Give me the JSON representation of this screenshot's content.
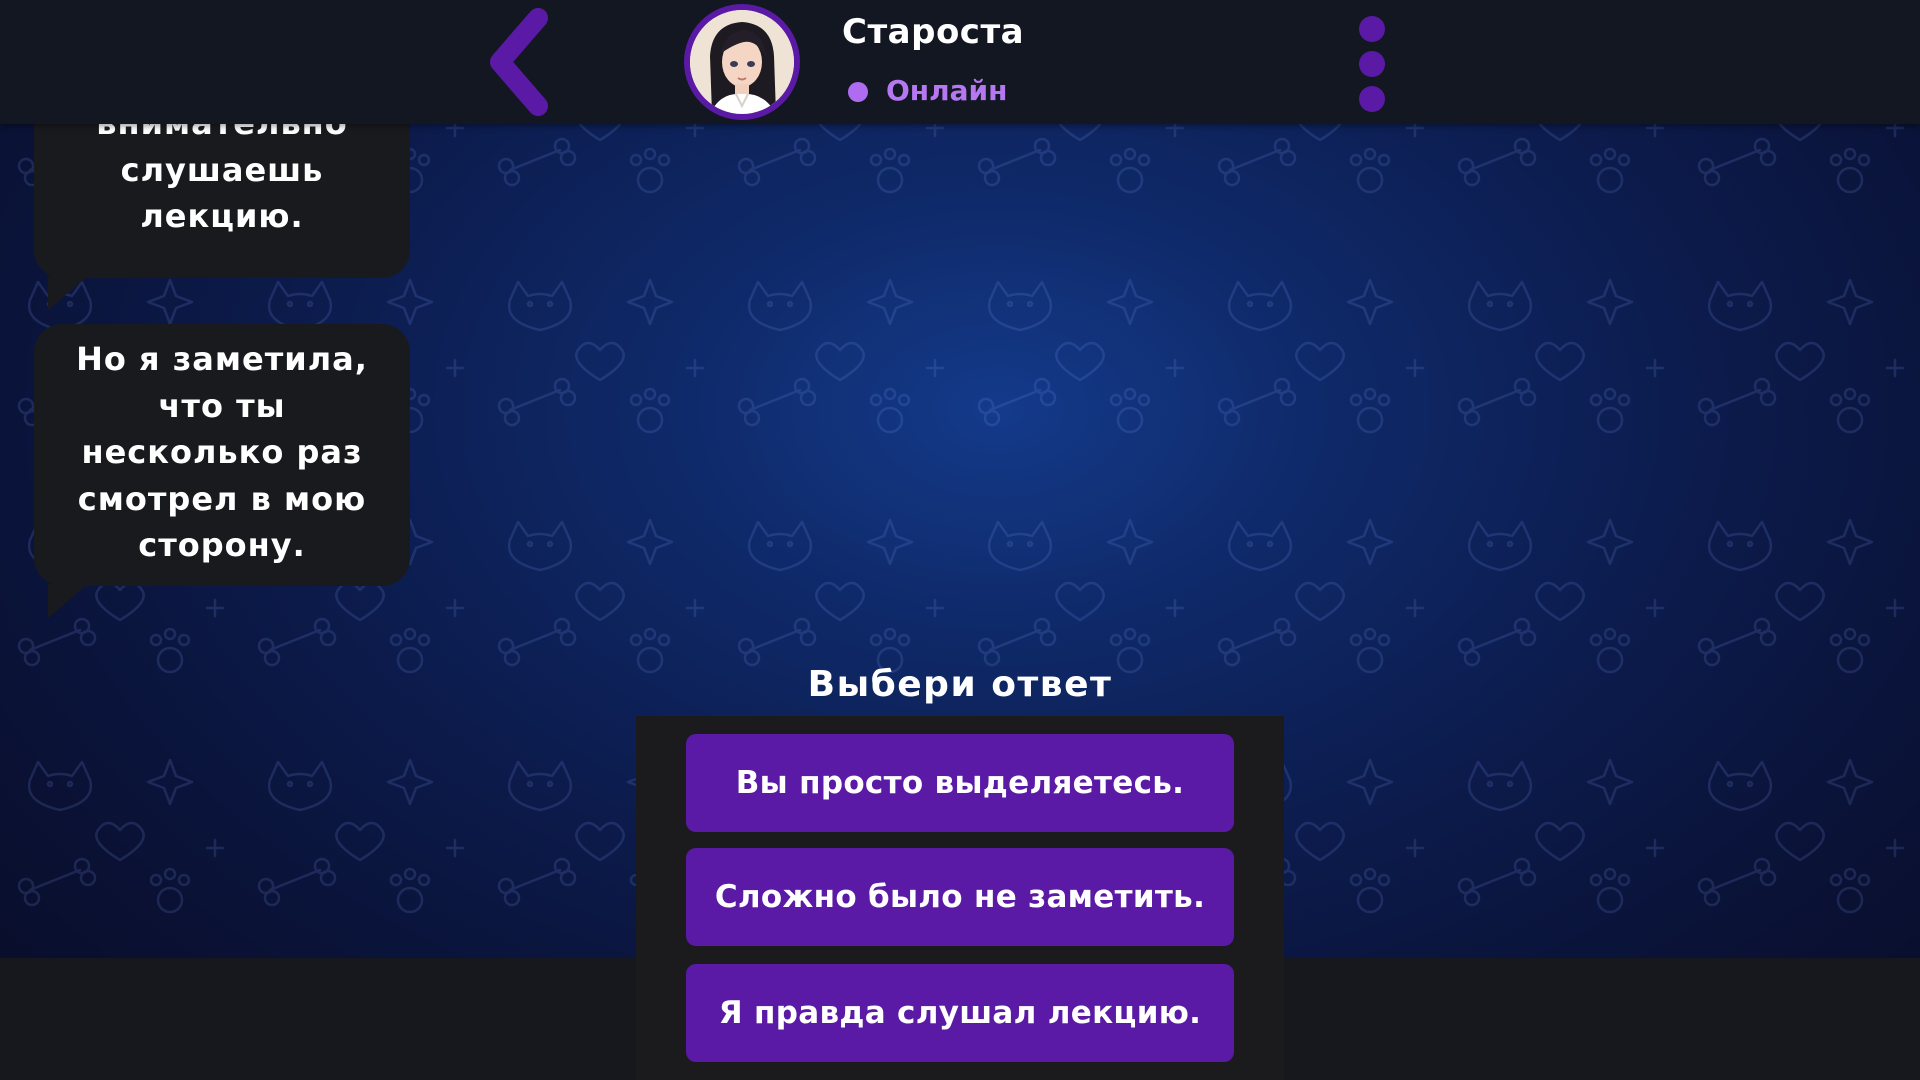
{
  "header": {
    "contact_name": "Староста",
    "status": "Онлайн",
    "back_icon": "chevron-left-icon",
    "menu_icon": "more-vertical-icon",
    "accent_color": "#5a1aa6",
    "status_color": "#b678f2"
  },
  "chat": {
    "messages": [
      {
        "sender": "contact",
        "lines": [
          "внимательно",
          "слушаешь",
          "лекцию."
        ]
      },
      {
        "sender": "contact",
        "lines": [
          "Но я заметила,",
          "что ты",
          "несколько раз",
          "смотрел в мою",
          "сторону."
        ]
      }
    ]
  },
  "choice": {
    "title": "Выбери ответ",
    "options": [
      "Вы просто выделяетесь.",
      "Сложно было не заметить.",
      "Я правда слушал лекцию."
    ],
    "button_color": "#5a1aa6"
  }
}
